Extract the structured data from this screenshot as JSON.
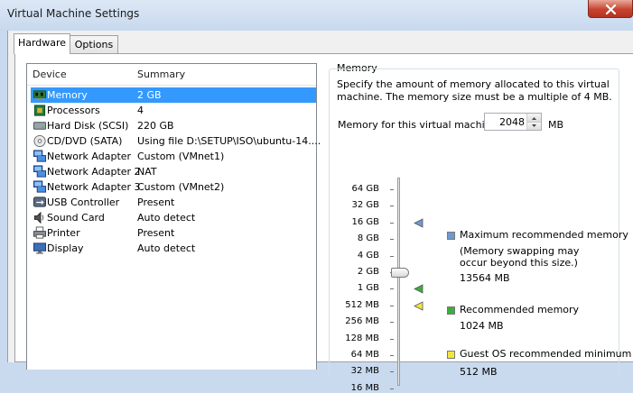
{
  "window": {
    "title": "Virtual Machine Settings"
  },
  "tabs": [
    {
      "label": "Hardware",
      "active": true
    },
    {
      "label": "Options",
      "active": false
    }
  ],
  "device_table": {
    "columns": [
      "Device",
      "Summary"
    ],
    "rows": [
      {
        "device": "Memory",
        "summary": "2 GB",
        "icon": "memory-icon",
        "selected": true
      },
      {
        "device": "Processors",
        "summary": "4",
        "icon": "processor-icon"
      },
      {
        "device": "Hard Disk (SCSI)",
        "summary": "220 GB",
        "icon": "hard-disk-icon"
      },
      {
        "device": "CD/DVD (SATA)",
        "summary": "Using file D:\\SETUP\\ISO\\ubuntu-14....",
        "icon": "cd-dvd-icon"
      },
      {
        "device": "Network Adapter",
        "summary": "Custom (VMnet1)",
        "icon": "network-adapter-icon"
      },
      {
        "device": "Network Adapter 2",
        "summary": "NAT",
        "icon": "network-adapter-icon"
      },
      {
        "device": "Network Adapter 3",
        "summary": "Custom (VMnet2)",
        "icon": "network-adapter-icon"
      },
      {
        "device": "USB Controller",
        "summary": "Present",
        "icon": "usb-icon"
      },
      {
        "device": "Sound Card",
        "summary": "Auto detect",
        "icon": "sound-card-icon"
      },
      {
        "device": "Printer",
        "summary": "Present",
        "icon": "printer-icon"
      },
      {
        "device": "Display",
        "summary": "Auto detect",
        "icon": "display-icon"
      }
    ]
  },
  "memory": {
    "group_title": "Memory",
    "description": "Specify the amount of memory allocated to this virtual machine. The memory size must be a multiple of 4 MB.",
    "field_label": "Memory for this virtual machine:",
    "value": "2048",
    "unit": "MB",
    "scale_labels": [
      "64 GB",
      "32 GB",
      "16 GB",
      "8 GB",
      "4 GB",
      "2 GB",
      "1 GB",
      "512 MB",
      "256 MB",
      "128 MB",
      "64 MB",
      "32 MB",
      "16 MB"
    ],
    "selected_scale_label": "2 GB",
    "markers": [
      {
        "name": "maximum-recommended",
        "at_label": "16 GB",
        "color": "#6e9ad0"
      },
      {
        "name": "recommended",
        "at_label": "1 GB",
        "color": "#3cae3c"
      },
      {
        "name": "guest-os-minimum",
        "at_label": "512 MB",
        "color": "#f2e541"
      }
    ],
    "legend": {
      "max_title": "Maximum recommended memory",
      "max_note_1": "(Memory swapping may",
      "max_note_2": "occur beyond this size.)",
      "max_value": "13564 MB",
      "rec_title": "Recommended memory",
      "rec_value": "1024 MB",
      "min_title": "Guest OS recommended minimum",
      "min_value": "512 MB"
    }
  },
  "colors": {
    "selection": "#3399ff",
    "max_marker": "#6e9ad0",
    "recommended_marker": "#3cae3c",
    "minimum_marker": "#f2e541"
  }
}
